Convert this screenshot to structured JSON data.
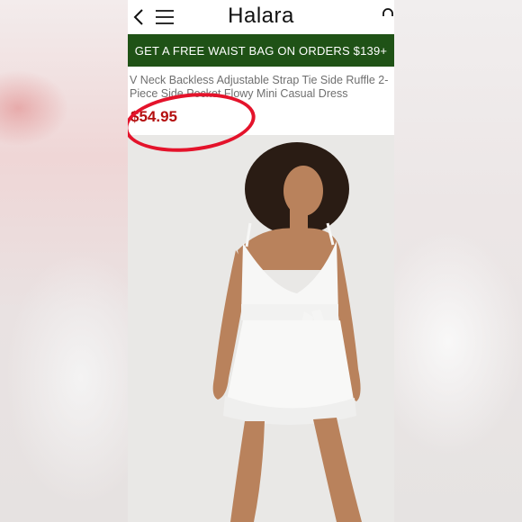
{
  "header": {
    "brand": "Halara",
    "icons": [
      "back-arrow-icon",
      "hamburger-menu-icon",
      "shopping-bag-icon"
    ]
  },
  "promo": {
    "text": "GET A FREE WAIST BAG ON ORDERS $139+"
  },
  "product": {
    "title": "V Neck Backless Adjustable Strap Tie Side Ruffle 2-Piece Side Pocket Flowy Mini Casual Dress",
    "price": "$54.95"
  },
  "colors": {
    "promo_bg": "#1f5216",
    "price": "#b40f0f",
    "highlight_circle": "#e4132b"
  }
}
